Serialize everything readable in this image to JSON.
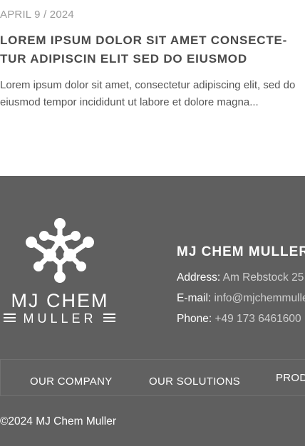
{
  "article": {
    "date": "APRIL 9 / 2024",
    "title": "LOREM IPSUM DOLOR SIT AMET CONSECTE- TUR ADIPISCIN ELIT SED DO EIUSMOD",
    "excerpt": "Lorem ipsum dolor sit amet, consectetur adipiscing elit, sed do eiusmod tempor incididunt ut labore et dolore magna..."
  },
  "footer": {
    "logo": {
      "line1": "MJ CHEM",
      "line2": "MULLER"
    },
    "company_name": "MJ CHEM MULLER",
    "address_label": "Address:",
    "address_value": "Am Rebstock 25",
    "email_label": "E-mail:",
    "email_value": "info@mjchemmuller.de",
    "phone_label": "Phone:",
    "phone_value": "+49 173 6461600",
    "nav": [
      "OUR COMPANY",
      "OUR SOLUTIONS",
      "PRODUCTS"
    ],
    "copyright": "©2024 MJ Chem Muller",
    "colors": {
      "background": "#5f5f5f",
      "text": "#ffffff",
      "muted": "#cfcfcf"
    }
  }
}
